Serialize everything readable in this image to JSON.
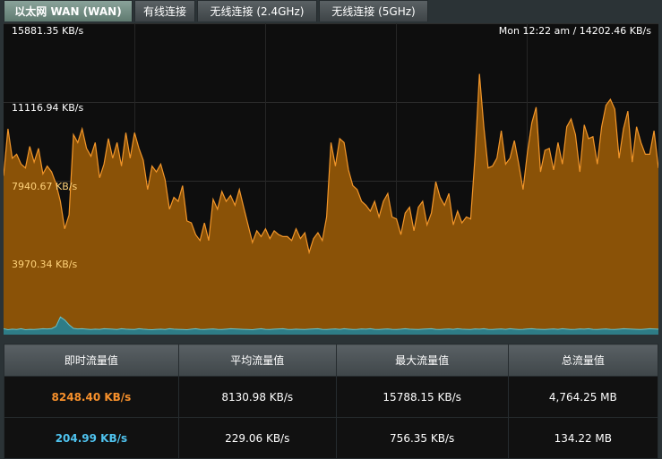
{
  "tabs": [
    {
      "label": "以太网 WAN (WAN)",
      "active": true
    },
    {
      "label": "有线连接",
      "active": false
    },
    {
      "label": "无线连接 (2.4GHz)",
      "active": false
    },
    {
      "label": "无线连接 (5GHz)",
      "active": false
    }
  ],
  "chart": {
    "y_labels": [
      "15881.35 KB/s",
      "11116.94 KB/s",
      "7940.67 KB/s",
      "3970.34 KB/s"
    ],
    "now_readout": "Mon 12:22 am / 14202.46 KB/s",
    "colors": {
      "rx_fill": "#8a5207",
      "rx_line": "#f2962a",
      "tx_fill": "#2e7c86",
      "tx_line": "#67c3cc"
    }
  },
  "chart_data": {
    "type": "area",
    "ylim": [
      0,
      15881.35
    ],
    "series": [
      {
        "values": [
          8100,
          10500,
          9000,
          9200,
          8700,
          8500,
          9600,
          8800,
          9500,
          8200,
          8600,
          8300,
          7700,
          6800,
          5400,
          6100,
          10200,
          9800,
          10500,
          9500,
          9100,
          9800,
          8000,
          8700,
          10000,
          9000,
          9800,
          8600,
          10300,
          9000,
          10300,
          9500,
          8900,
          7400,
          8600,
          8300,
          8700,
          7900,
          6400,
          7000,
          6800,
          7600,
          5800,
          5700,
          5100,
          4800,
          5700,
          4800,
          6900,
          6400,
          7300,
          6800,
          7100,
          6600,
          7400,
          6500,
          5600,
          4700,
          5300,
          5000,
          5400,
          4900,
          5300,
          5100,
          5000,
          5000,
          4800,
          5400,
          4900,
          5200,
          4200,
          4900,
          5200,
          4800,
          6000,
          9800,
          8600,
          10000,
          9800,
          8400,
          7600,
          7400,
          6800,
          6600,
          6300,
          6800,
          6000,
          6800,
          7200,
          6000,
          5900,
          5100,
          6200,
          6500,
          5300,
          6500,
          6800,
          5600,
          6200,
          7800,
          7000,
          6600,
          7200,
          5600,
          6300,
          5700,
          6000,
          5900,
          9100,
          13300,
          10600,
          8500,
          8600,
          9000,
          10400,
          8700,
          9000,
          9900,
          8700,
          7400,
          9300,
          10800,
          11600,
          8300,
          9400,
          9500,
          8400,
          9800,
          8700,
          10600,
          11000,
          10200,
          8300,
          10700,
          10000,
          10100,
          8700,
          10600,
          11700,
          12000,
          11500,
          9000,
          10500,
          11400,
          8800,
          10600,
          9800,
          9200,
          9200,
          10400,
          8500
        ]
      },
      {
        "values": [
          300,
          250,
          280,
          260,
          300,
          250,
          270,
          260,
          280,
          300,
          290,
          310,
          420,
          900,
          750,
          500,
          320,
          290,
          300,
          280,
          260,
          280,
          270,
          300,
          290,
          280,
          260,
          300,
          280,
          270,
          260,
          300,
          280,
          260,
          250,
          270,
          280,
          260,
          300,
          280,
          270,
          260,
          250,
          280,
          300,
          270,
          260,
          280,
          290,
          270,
          260,
          280,
          300,
          290,
          280,
          270,
          260,
          250,
          280,
          300,
          270,
          260,
          280,
          290,
          300,
          270,
          260,
          280,
          270,
          260,
          280,
          290,
          300,
          270,
          260,
          280,
          290,
          270,
          300,
          280,
          260,
          270,
          290,
          280,
          300,
          270,
          260,
          280,
          290,
          270,
          260,
          280,
          300,
          280,
          270,
          260,
          280,
          290,
          300,
          270,
          260,
          280,
          290,
          270,
          300,
          280,
          270,
          260,
          290,
          280,
          300,
          270,
          260,
          280,
          290,
          270,
          300,
          280,
          260,
          270,
          290,
          300,
          280,
          270,
          260,
          280,
          290,
          270,
          300,
          280,
          260,
          270,
          290,
          280,
          300,
          270,
          260,
          280,
          290,
          270,
          260,
          280,
          300,
          290,
          280,
          270,
          260,
          280,
          300,
          290,
          280
        ]
      }
    ]
  },
  "stats": {
    "headers": [
      "即时流量值",
      "平均流量值",
      "最大流量值",
      "总流量值"
    ],
    "rows": [
      [
        "8248.40 KB/s",
        "8130.98 KB/s",
        "15788.15 KB/s",
        "4,764.25 MB"
      ],
      [
        "204.99 KB/s",
        "229.06 KB/s",
        "756.35 KB/s",
        "134.22 MB"
      ]
    ]
  }
}
